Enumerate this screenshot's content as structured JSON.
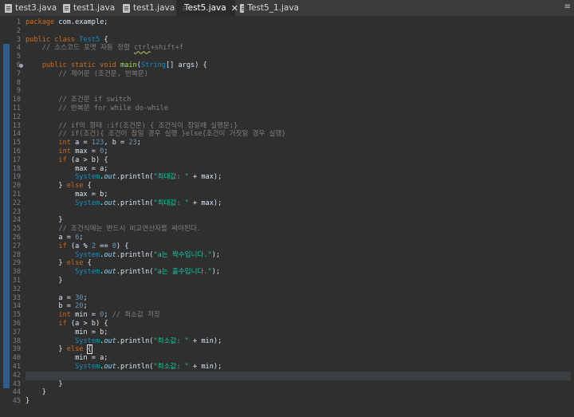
{
  "tabs": [
    {
      "label": "test3.java",
      "active": false
    },
    {
      "label": "test1.java",
      "active": false
    },
    {
      "label": "test1.java",
      "active": false
    },
    {
      "label": "Test5.java",
      "active": true
    },
    {
      "label": "Test5_1.java",
      "active": false
    }
  ],
  "tab_close_glyph": "✕",
  "tab_menu_glyph": "≡",
  "editor": {
    "line_count": 44,
    "current_line": 42,
    "lines": [
      [
        [
          "kw",
          "package"
        ],
        [
          "p",
          " com.example;"
        ]
      ],
      [],
      [
        [
          "kw",
          "public class"
        ],
        [
          "p",
          " "
        ],
        [
          "cls",
          "Test5"
        ],
        [
          "p",
          " {"
        ]
      ],
      [
        [
          "p",
          "    "
        ],
        [
          "com",
          "// 소스코드 포맷 자동 정렬 "
        ],
        [
          "comsq",
          "ctrl"
        ],
        [
          "com",
          "+shift+f"
        ]
      ],
      [],
      [
        [
          "p",
          "    "
        ],
        [
          "kw",
          "public static void"
        ],
        [
          "p",
          " "
        ],
        [
          "fn",
          "main"
        ],
        [
          "p",
          "("
        ],
        [
          "cls",
          "String"
        ],
        [
          "p",
          "[] "
        ],
        [
          "p",
          "args) {"
        ]
      ],
      [
        [
          "p",
          "        "
        ],
        [
          "com",
          "// 제어문 (조건문, 반복문)"
        ]
      ],
      [],
      [],
      [
        [
          "p",
          "        "
        ],
        [
          "com",
          "// 조건문 if switch"
        ]
      ],
      [
        [
          "p",
          "        "
        ],
        [
          "com",
          "// 반복문 for while do-while"
        ]
      ],
      [],
      [
        [
          "p",
          "        "
        ],
        [
          "com",
          "// if의 형태 :if(조건문) { 조건식이 참일때 실행문;}"
        ]
      ],
      [
        [
          "p",
          "        "
        ],
        [
          "com",
          "// if(조건){ 조건이 참일 경우 실행 }else{조건이 거짓일 경우 실행}"
        ]
      ],
      [
        [
          "p",
          "        "
        ],
        [
          "kw",
          "int"
        ],
        [
          "p",
          " a = "
        ],
        [
          "num",
          "123"
        ],
        [
          "p",
          ", b = "
        ],
        [
          "num",
          "23"
        ],
        [
          "p",
          ";"
        ]
      ],
      [
        [
          "p",
          "        "
        ],
        [
          "kw",
          "int"
        ],
        [
          "p",
          " max = "
        ],
        [
          "num",
          "0"
        ],
        [
          "p",
          ";"
        ]
      ],
      [
        [
          "p",
          "        "
        ],
        [
          "kw",
          "if"
        ],
        [
          "p",
          " (a > b) {"
        ]
      ],
      [
        [
          "p",
          "            max = a;"
        ]
      ],
      [
        [
          "p",
          "            "
        ],
        [
          "cls",
          "System"
        ],
        [
          "p",
          "."
        ],
        [
          "field",
          "out"
        ],
        [
          "p",
          ".println("
        ],
        [
          "str",
          "\"최대값: \""
        ],
        [
          "p",
          " + max);"
        ]
      ],
      [
        [
          "p",
          "        } "
        ],
        [
          "kw",
          "else"
        ],
        [
          "p",
          " {"
        ]
      ],
      [
        [
          "p",
          "            max = b;"
        ]
      ],
      [
        [
          "p",
          "            "
        ],
        [
          "cls",
          "System"
        ],
        [
          "p",
          "."
        ],
        [
          "field",
          "out"
        ],
        [
          "p",
          ".println("
        ],
        [
          "str",
          "\"최대값: \""
        ],
        [
          "p",
          " + max);"
        ]
      ],
      [],
      [
        [
          "p",
          "        }"
        ]
      ],
      [
        [
          "p",
          "        "
        ],
        [
          "com",
          "// 조건식에는 반드시 비교연산자를 써야된다."
        ]
      ],
      [
        [
          "p",
          "        a = "
        ],
        [
          "num",
          "6"
        ],
        [
          "p",
          ";"
        ]
      ],
      [
        [
          "p",
          "        "
        ],
        [
          "kw",
          "if"
        ],
        [
          "p",
          " (a % "
        ],
        [
          "num",
          "2"
        ],
        [
          "p",
          " == "
        ],
        [
          "num",
          "0"
        ],
        [
          "p",
          ") {"
        ]
      ],
      [
        [
          "p",
          "            "
        ],
        [
          "cls",
          "System"
        ],
        [
          "p",
          "."
        ],
        [
          "field",
          "out"
        ],
        [
          "p",
          ".println("
        ],
        [
          "str",
          "\"a는 짝수입니다.\""
        ],
        [
          "p",
          ");"
        ]
      ],
      [
        [
          "p",
          "        } "
        ],
        [
          "kw",
          "else"
        ],
        [
          "p",
          " {"
        ]
      ],
      [
        [
          "p",
          "            "
        ],
        [
          "cls",
          "System"
        ],
        [
          "p",
          "."
        ],
        [
          "field",
          "out"
        ],
        [
          "p",
          ".println("
        ],
        [
          "str",
          "\"a는 홀수입니다.\""
        ],
        [
          "p",
          ");"
        ]
      ],
      [
        [
          "p",
          "        }"
        ]
      ],
      [],
      [
        [
          "p",
          "        a = "
        ],
        [
          "num",
          "30"
        ],
        [
          "p",
          ";"
        ]
      ],
      [
        [
          "p",
          "        b = "
        ],
        [
          "num",
          "20"
        ],
        [
          "p",
          ";"
        ]
      ],
      [
        [
          "p",
          "        "
        ],
        [
          "kw",
          "int"
        ],
        [
          "p",
          " min = "
        ],
        [
          "num",
          "0"
        ],
        [
          "p",
          "; "
        ],
        [
          "com",
          "// 최소값 저장"
        ]
      ],
      [
        [
          "p",
          "        "
        ],
        [
          "kw",
          "if"
        ],
        [
          "p",
          " (a > b) {"
        ]
      ],
      [
        [
          "p",
          "            min = b;"
        ]
      ],
      [
        [
          "p",
          "            "
        ],
        [
          "cls",
          "System"
        ],
        [
          "p",
          "."
        ],
        [
          "field",
          "out"
        ],
        [
          "p",
          ".println("
        ],
        [
          "str",
          "\"최소값: \""
        ],
        [
          "p",
          " + min);"
        ]
      ],
      [
        [
          "p",
          "        } "
        ],
        [
          "kw",
          "else"
        ],
        [
          "p",
          " "
        ],
        [
          "cur",
          "{"
        ]
      ],
      [
        [
          "p",
          "            min = a;"
        ]
      ],
      [
        [
          "p",
          "            "
        ],
        [
          "cls",
          "System"
        ],
        [
          "p",
          "."
        ],
        [
          "field",
          "out"
        ],
        [
          "p",
          ".println("
        ],
        [
          "str",
          "\"최소값: \""
        ],
        [
          "p",
          " + min);"
        ]
      ],
      [],
      [
        [
          "p",
          "        }"
        ]
      ],
      [
        [
          "p",
          "    }"
        ]
      ],
      [
        [
          "p",
          "}"
        ]
      ]
    ]
  }
}
